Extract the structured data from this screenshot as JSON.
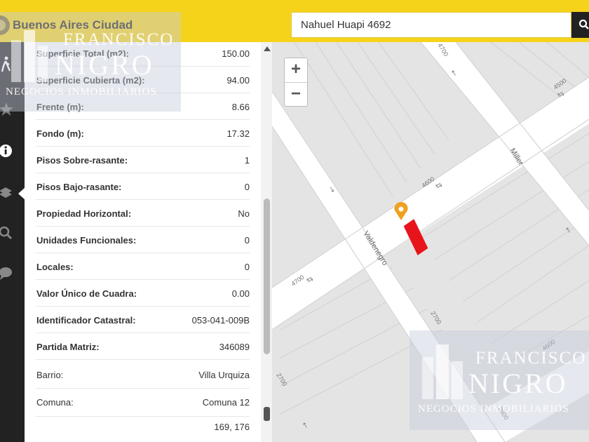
{
  "header": {
    "brand": "Buenos Aires Ciudad",
    "search_value": "Nahuel Huapi 4692"
  },
  "parcel_info": {
    "rows": [
      {
        "label": "Superficie Total (m2):",
        "value": "150.00"
      },
      {
        "label": "Superficie Cubierta (m2):",
        "value": "94.00"
      },
      {
        "label": "Frente (m):",
        "value": "8.66"
      },
      {
        "label": "Fondo (m):",
        "value": "17.32"
      },
      {
        "label": "Pisos Sobre-rasante:",
        "value": "1"
      },
      {
        "label": "Pisos Bajo-rasante:",
        "value": "0"
      },
      {
        "label": "Propiedad Horizontal:",
        "value": "No"
      },
      {
        "label": "Unidades Funcionales:",
        "value": "0"
      },
      {
        "label": "Locales:",
        "value": "0"
      },
      {
        "label": "Valor Único de Cuadra:",
        "value": "0.00"
      },
      {
        "label": "Identificador Catastral:",
        "value": "053-041-009B"
      },
      {
        "label": "Partida Matriz:",
        "value": "346089"
      },
      {
        "label": "Barrio:",
        "value": "Villa Urquiza"
      },
      {
        "label": "Comuna:",
        "value": "Comuna 12"
      },
      {
        "label": "",
        "value": "169, 176"
      }
    ]
  },
  "map": {
    "zoom_in": "+",
    "zoom_out": "−",
    "street_labels": {
      "valdenegro": "Valdenegro",
      "miller": "Miller",
      "n4600a": "4600",
      "n4600b": "4600",
      "n4700a": "4700",
      "n4700b": "4700",
      "n4500": "4500",
      "n2700": "2700",
      "n2800": "2800",
      "n2700b": "2700"
    },
    "parcel_color": "#e8141c",
    "marker_color": "#f0a020"
  },
  "watermark": {
    "line1": "FRANCISCO",
    "line2": "NIGRO",
    "line3": "NEGOCIOS INMOBILIARIOS"
  },
  "sidebar_icons": [
    "walk-icon",
    "star-icon",
    "info-icon",
    "layers-icon",
    "search-icon",
    "chat-icon"
  ]
}
